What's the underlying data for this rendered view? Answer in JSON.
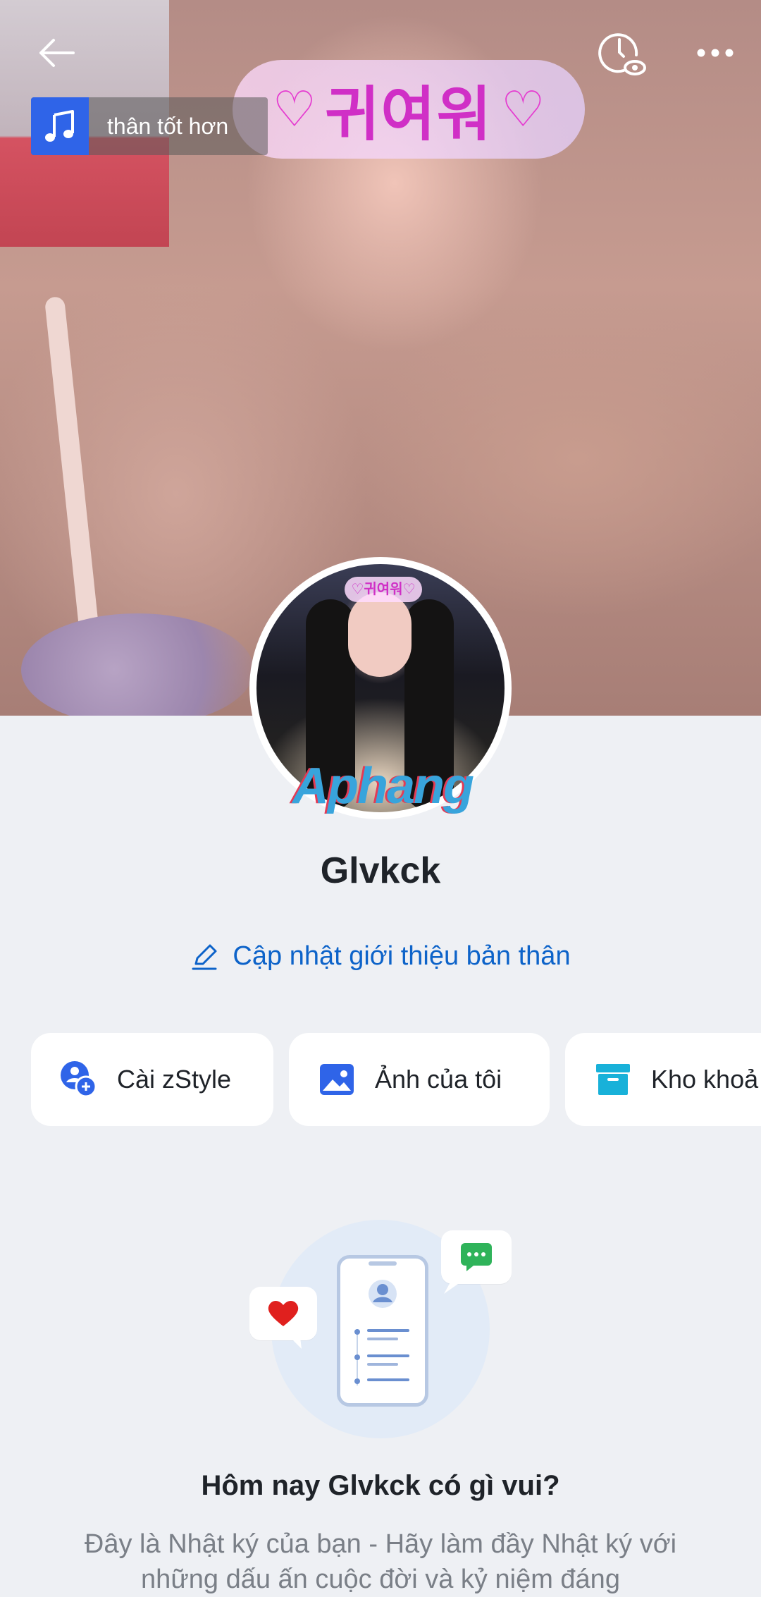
{
  "cover": {
    "sticker_text": "귀여워",
    "music_label": "thân tốt hơn"
  },
  "watermark": {
    "text": "Aphang"
  },
  "profile": {
    "name": "Glvkck",
    "edit_bio_label": "Cập nhật giới thiệu bản thân"
  },
  "shortcuts": [
    {
      "label": "Cài zStyle",
      "icon": "zstyle-icon"
    },
    {
      "label": "Ảnh của tôi",
      "icon": "photo-icon"
    },
    {
      "label": "Kho khoả",
      "icon": "archive-icon"
    }
  ],
  "diary": {
    "title": "Hôm nay Glvkck có gì vui?",
    "description": "Đây là Nhật ký của bạn - Hãy làm đầy Nhật ký với những dấu ấn cuộc đời và kỷ niệm đáng"
  },
  "colors": {
    "accent_blue": "#0d63c9",
    "music_blue": "#2f64e8",
    "background": "#eef0f4",
    "heart_red": "#e0201e",
    "chat_green": "#2fb35a"
  }
}
